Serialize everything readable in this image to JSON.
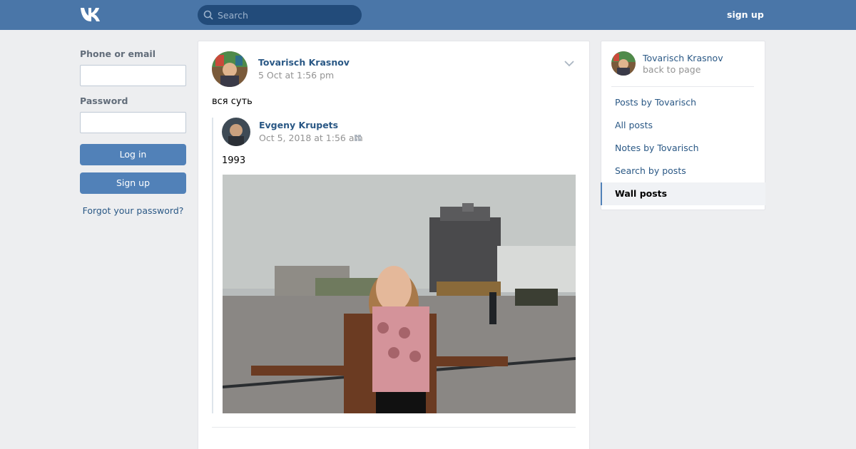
{
  "header": {
    "search_placeholder": "Search",
    "signup_label": "sign up",
    "brand_color": "#4a76a8"
  },
  "login": {
    "phone_label": "Phone or email",
    "password_label": "Password",
    "login_button": "Log in",
    "signup_button": "Sign up",
    "forgot_link": "Forgot your password?"
  },
  "post": {
    "author": "Tovarisch Krasnov",
    "date": "5 Oct at 1:56 pm",
    "text": "вся суть",
    "repost": {
      "author": "Evgeny Krupets",
      "date": "Oct 5, 2018 at 1:56 am",
      "text": "1993"
    }
  },
  "sidebar": {
    "profile_name": "Tovarisch Krasnov",
    "back_label": "back to page",
    "items": [
      {
        "label": "Posts by Tovarisch"
      },
      {
        "label": "All posts"
      },
      {
        "label": "Notes by Tovarisch"
      },
      {
        "label": "Search by posts"
      },
      {
        "label": "Wall posts",
        "active": true
      }
    ]
  }
}
